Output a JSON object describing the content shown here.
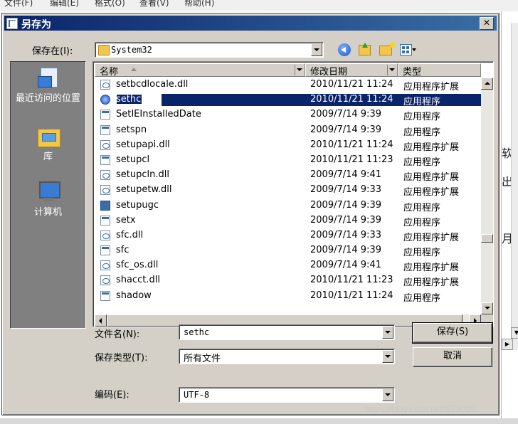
{
  "background": {
    "menu": [
      "文件(F)",
      "编辑(E)",
      "格式(O)",
      "查看(V)",
      "帮助(H)"
    ],
    "right_fragments": [
      "软",
      "出",
      "月"
    ]
  },
  "dialog": {
    "title": "另存为",
    "close_label": "✕",
    "save_in_label": "保存在(I):",
    "save_in_value": "System32",
    "places": [
      {
        "label": "最近访问的位置",
        "icon": "recent-places-icon"
      },
      {
        "label": "库",
        "icon": "libraries-icon"
      },
      {
        "label": "计算机",
        "icon": "computer-icon"
      }
    ],
    "columns": {
      "name": "名称",
      "date": "修改日期",
      "type": "类型"
    },
    "files": [
      {
        "name": "setbcdlocale.dll",
        "date": "2010/11/21 11:24",
        "type": "应用程序扩展",
        "icon": "dll"
      },
      {
        "name": "sethc",
        "date": "2010/11/21 11:24",
        "type": "应用程序",
        "icon": "clock",
        "selected": true
      },
      {
        "name": "SetIEInstalledDate",
        "date": "2009/7/14 9:39",
        "type": "应用程序",
        "icon": "exe"
      },
      {
        "name": "setspn",
        "date": "2009/7/14 9:39",
        "type": "应用程序",
        "icon": "exe"
      },
      {
        "name": "setupapi.dll",
        "date": "2010/11/21 11:24",
        "type": "应用程序扩展",
        "icon": "dll"
      },
      {
        "name": "setupcl",
        "date": "2010/11/21 11:23",
        "type": "应用程序",
        "icon": "exe"
      },
      {
        "name": "setupcln.dll",
        "date": "2009/7/14 9:41",
        "type": "应用程序扩展",
        "icon": "dll"
      },
      {
        "name": "setupetw.dll",
        "date": "2009/7/14 9:33",
        "type": "应用程序扩展",
        "icon": "dll"
      },
      {
        "name": "setupugc",
        "date": "2009/7/14 9:39",
        "type": "应用程序",
        "icon": "gear"
      },
      {
        "name": "setx",
        "date": "2009/7/14 9:39",
        "type": "应用程序",
        "icon": "exe"
      },
      {
        "name": "sfc.dll",
        "date": "2009/7/14 9:33",
        "type": "应用程序扩展",
        "icon": "dll"
      },
      {
        "name": "sfc",
        "date": "2009/7/14 9:39",
        "type": "应用程序",
        "icon": "exe"
      },
      {
        "name": "sfc_os.dll",
        "date": "2009/7/14 9:41",
        "type": "应用程序扩展",
        "icon": "dll"
      },
      {
        "name": "shacct.dll",
        "date": "2010/11/21 11:23",
        "type": "应用程序扩展",
        "icon": "dll"
      },
      {
        "name": "shadow",
        "date": "2010/11/21 11:24",
        "type": "应用程序",
        "icon": "exe"
      }
    ],
    "filename_label": "文件名(N):",
    "filename_value": "sethc",
    "filetype_label": "保存类型(T):",
    "filetype_value": "所有文件",
    "encoding_label": "编码(E):",
    "encoding_value": "UTF-8",
    "save_button": "保存(S)",
    "cancel_button": "取消"
  },
  "watermark": "https://blog.csdn.net/l578000",
  "colors": {
    "titlebar": "#0a246a",
    "selection": "#0a246a",
    "face": "#d4d0c8",
    "places_bg": "#808080"
  }
}
